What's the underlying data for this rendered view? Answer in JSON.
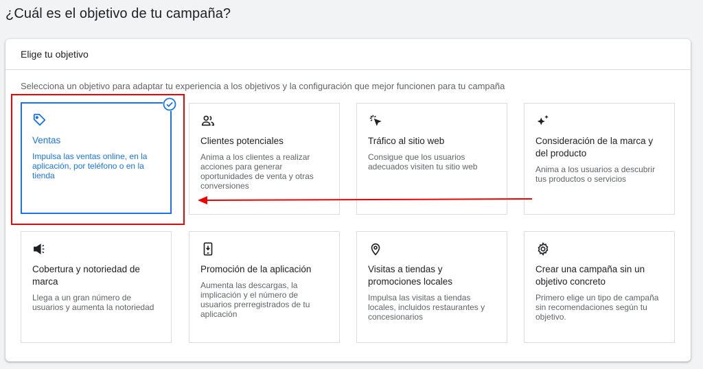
{
  "page": {
    "title": "¿Cuál es el objetivo de tu campaña?"
  },
  "panel": {
    "header": "Elige tu objetivo",
    "instructions": "Selecciona un objetivo para adaptar tu experiencia a los objetivos y la configuración que mejor funcionen para tu campaña"
  },
  "colors": {
    "accent": "#1a73e8",
    "annotation": "#e00000"
  },
  "cards": [
    {
      "icon": "tag-icon",
      "title": "Ventas",
      "desc": "Impulsa las ventas online, en la aplicación, por teléfono o en la tienda",
      "selected": true
    },
    {
      "icon": "people-icon",
      "title": "Clientes potenciales",
      "desc": "Anima a los clientes a realizar acciones para generar oportunidades de venta y otras conversiones",
      "selected": false
    },
    {
      "icon": "cursor-click-icon",
      "title": "Tráfico al sitio web",
      "desc": "Consigue que los usuarios adecuados visiten tu sitio web",
      "selected": false
    },
    {
      "icon": "sparkle-icon",
      "title": "Consideración de la marca y del producto",
      "desc": "Anima a los usuarios a descubrir tus productos o servicios",
      "selected": false
    },
    {
      "icon": "megaphone-icon",
      "title": "Cobertura y notoriedad de marca",
      "desc": "Llega a un gran número de usuarios y aumenta la notoriedad",
      "selected": false
    },
    {
      "icon": "phone-download-icon",
      "title": "Promoción de la aplicación",
      "desc": "Aumenta las descargas, la implicación y el número de usuarios prerregistrados de tu aplicación",
      "selected": false
    },
    {
      "icon": "location-pin-icon",
      "title": "Visitas a tiendas y promociones locales",
      "desc": "Impulsa las visitas a tiendas locales, incluidos restaurantes y concesionarios",
      "selected": false
    },
    {
      "icon": "gear-icon",
      "title": "Crear una campaña sin un objetivo concreto",
      "desc": "Primero elige un tipo de campaña sin recomendaciones según tu objetivo.",
      "selected": false
    }
  ]
}
